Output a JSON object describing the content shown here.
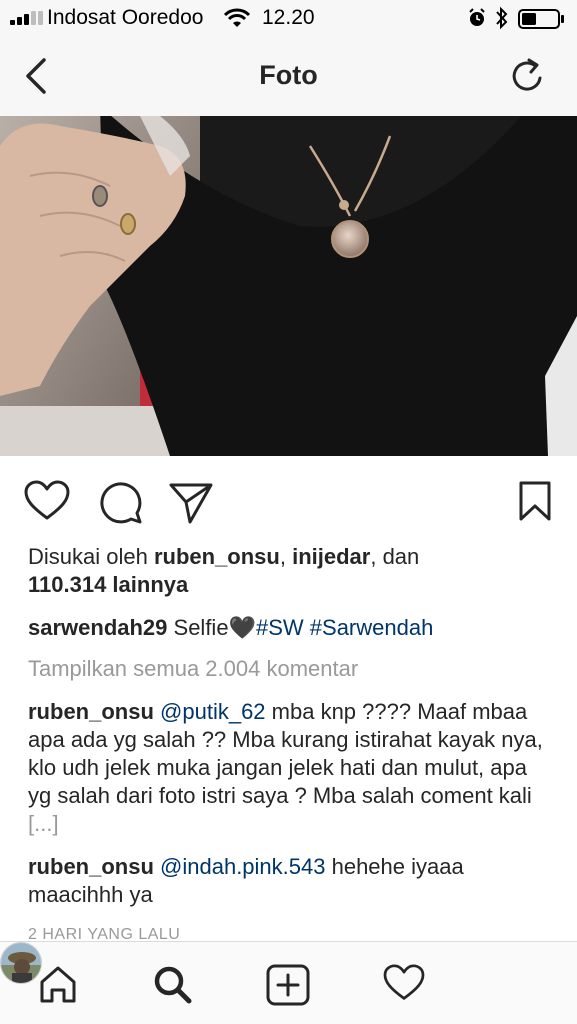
{
  "status_bar": {
    "carrier": "Indosat Ooredoo",
    "time": "12.20"
  },
  "nav": {
    "title": "Foto"
  },
  "post": {
    "likes_prefix": "Disukai oleh ",
    "liked_by_1": "ruben_onsu",
    "separator": ", ",
    "liked_by_2": "inijedar",
    "connector": ", dan",
    "likes_count": "110.314 lainnya",
    "caption_user": "sarwendah29",
    "caption_text": " Selfie",
    "caption_emoji": "🖤",
    "caption_tag_1": "#SW",
    "caption_tag_2": "#Sarwendah",
    "view_all_comments": "Tampilkan semua 2.004 komentar",
    "comments": [
      {
        "user": "ruben_onsu",
        "mention": "@putik_62",
        "text": " mba knp ???? Maaf mbaa apa ada yg salah ?? Mba kurang istirahat kayak nya, klo udh jelek muka jangan jelek hati dan mulut, apa yg salah dari foto istri saya ? Mba salah coment kali ",
        "more": "[...]"
      },
      {
        "user": "ruben_onsu",
        "mention": "@indah.pink.543",
        "text": " hehehe iyaaa maacihhh ya"
      }
    ],
    "timestamp": "2 HARI YANG LALU"
  },
  "icons": {
    "back": "chevron-left-icon",
    "refresh": "refresh-icon",
    "like": "heart-icon",
    "comment": "comment-bubble-icon",
    "share": "paper-plane-icon",
    "bookmark": "bookmark-icon",
    "tabs": [
      "home-icon",
      "search-icon",
      "add-icon",
      "heart-icon",
      "avatar"
    ]
  },
  "colors": {
    "text": "#262626",
    "link": "#003569",
    "muted": "#999999",
    "bar_bg": "#f7f7f7"
  }
}
